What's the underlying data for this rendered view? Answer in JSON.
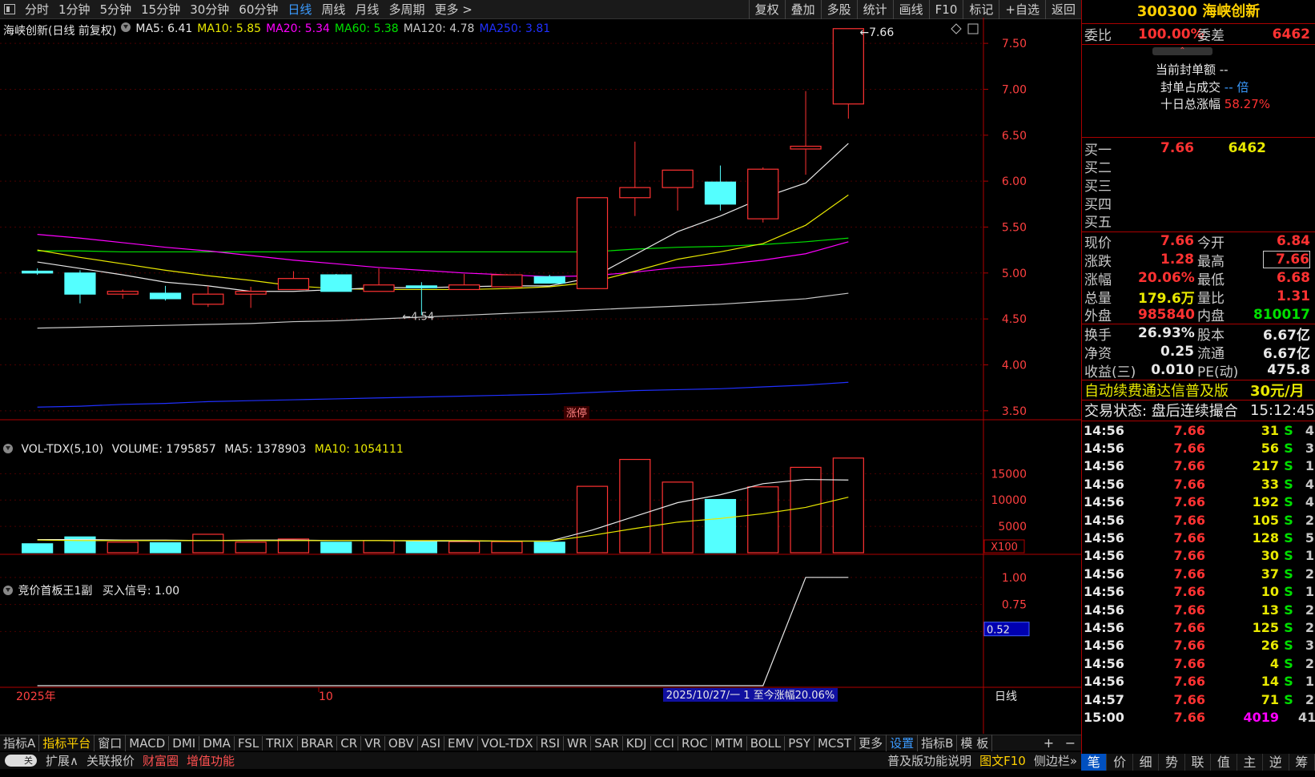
{
  "topbar": {
    "periods": [
      "分时",
      "1分钟",
      "5分钟",
      "15分钟",
      "30分钟",
      "60分钟",
      "日线",
      "周线",
      "月线",
      "多周期",
      "更多 >"
    ],
    "active_period": "日线",
    "tools": [
      "复权",
      "叠加",
      "多股",
      "统计",
      "画线",
      "F10",
      "标记",
      "+自选",
      "返回"
    ]
  },
  "main_legend": {
    "name": "海峡创新(日线 前复权)",
    "ma5": "MA5: 6.41",
    "ma10": "MA10: 5.85",
    "ma20": "MA20: 5.34",
    "ma60": "MA60: 5.38",
    "ma120": "MA120: 4.78",
    "ma250": "MA250: 3.81"
  },
  "colors": {
    "up": "#ff3232",
    "down": "#54ffff",
    "ma5": "#e8e8e8",
    "ma10": "#e8e800",
    "ma20": "#ff00ff",
    "ma60": "#00e000",
    "ma120": "#c8c8c8",
    "ma250": "#2030ff",
    "axis": "#b00000"
  },
  "price_axis": [
    "7.50",
    "7.00",
    "6.50",
    "6.00",
    "5.50",
    "5.00",
    "4.50",
    "4.00",
    "3.50"
  ],
  "annotations": {
    "high": "7.66",
    "low": "4.54",
    "zhangting": "涨停"
  },
  "vol_legend": {
    "name": "VOL-TDX(5,10)",
    "volume": "VOLUME: 1795857",
    "ma5": "MA5: 1378903",
    "ma10": "MA10: 1054111"
  },
  "vol_axis": [
    "15000",
    "10000",
    "5000"
  ],
  "vol_unit": "X100",
  "ind_legend": {
    "name": "竞价首板王1副",
    "signal": "买入信号: 1.00"
  },
  "ind_axis": [
    "1.00",
    "0.75",
    "0.50"
  ],
  "ind_current": "0.52",
  "x_axis": {
    "year": "2025年",
    "month": "10",
    "period": "日线"
  },
  "range_info": "2025/10/27/一 1 至今涨幅20.06%",
  "chart_data": {
    "type": "candlestick",
    "candles": [
      {
        "o": 5.02,
        "h": 5.05,
        "l": 4.98,
        "c": 5.0
      },
      {
        "o": 5.0,
        "h": 5.03,
        "l": 4.67,
        "c": 4.77
      },
      {
        "o": 4.77,
        "h": 4.82,
        "l": 4.72,
        "c": 4.8
      },
      {
        "o": 4.78,
        "h": 4.86,
        "l": 4.7,
        "c": 4.72
      },
      {
        "o": 4.66,
        "h": 4.86,
        "l": 4.63,
        "c": 4.77
      },
      {
        "o": 4.77,
        "h": 4.85,
        "l": 4.62,
        "c": 4.8
      },
      {
        "o": 4.82,
        "h": 5.02,
        "l": 4.82,
        "c": 4.94
      },
      {
        "o": 4.98,
        "h": 4.99,
        "l": 4.8,
        "c": 4.8
      },
      {
        "o": 4.8,
        "h": 5.05,
        "l": 4.8,
        "c": 4.87
      },
      {
        "o": 4.86,
        "h": 4.9,
        "l": 4.54,
        "c": 4.84
      },
      {
        "o": 4.82,
        "h": 4.99,
        "l": 4.82,
        "c": 4.87
      },
      {
        "o": 4.85,
        "h": 4.99,
        "l": 4.85,
        "c": 4.98
      },
      {
        "o": 4.96,
        "h": 4.98,
        "l": 4.89,
        "c": 4.89
      },
      {
        "o": 4.83,
        "h": 5.82,
        "l": 4.83,
        "c": 5.82
      },
      {
        "o": 5.82,
        "h": 6.43,
        "l": 5.62,
        "c": 5.93
      },
      {
        "o": 5.93,
        "h": 6.12,
        "l": 5.68,
        "c": 6.12
      },
      {
        "o": 5.99,
        "h": 6.17,
        "l": 5.68,
        "c": 5.75
      },
      {
        "o": 5.59,
        "h": 6.15,
        "l": 5.55,
        "c": 6.13
      },
      {
        "o": 6.35,
        "h": 6.98,
        "l": 6.07,
        "c": 6.38
      },
      {
        "o": 6.84,
        "h": 7.66,
        "l": 6.68,
        "c": 7.66
      }
    ],
    "ma5": [
      5.12,
      5.05,
      4.98,
      4.9,
      4.86,
      4.8,
      4.8,
      4.82,
      4.84,
      4.84,
      4.85,
      4.86,
      4.86,
      4.95,
      5.2,
      5.45,
      5.62,
      5.82,
      5.98,
      6.41
    ],
    "ma10": [
      5.25,
      5.17,
      5.1,
      5.03,
      4.97,
      4.92,
      4.86,
      4.83,
      4.82,
      4.82,
      4.82,
      4.83,
      4.85,
      4.9,
      5.02,
      5.15,
      5.23,
      5.32,
      5.52,
      5.85
    ],
    "ma20": [
      5.42,
      5.38,
      5.33,
      5.28,
      5.24,
      5.19,
      5.14,
      5.1,
      5.06,
      5.03,
      5.0,
      4.98,
      4.96,
      4.97,
      5.01,
      5.06,
      5.09,
      5.14,
      5.21,
      5.34
    ],
    "ma60": [
      5.24,
      5.24,
      5.23,
      5.23,
      5.23,
      5.23,
      5.23,
      5.23,
      5.23,
      5.23,
      5.23,
      5.23,
      5.23,
      5.23,
      5.26,
      5.28,
      5.29,
      5.31,
      5.34,
      5.38
    ],
    "ma120": [
      4.4,
      4.41,
      4.42,
      4.43,
      4.44,
      4.45,
      4.47,
      4.48,
      4.5,
      4.52,
      4.54,
      4.56,
      4.58,
      4.6,
      4.62,
      4.64,
      4.66,
      4.69,
      4.72,
      4.78
    ],
    "ma250": [
      3.54,
      3.55,
      3.57,
      3.58,
      3.6,
      3.61,
      3.62,
      3.63,
      3.64,
      3.65,
      3.66,
      3.67,
      3.68,
      3.7,
      3.72,
      3.73,
      3.74,
      3.76,
      3.78,
      3.81
    ],
    "volumes": [
      1700,
      3000,
      2000,
      1900,
      3500,
      2000,
      2600,
      2000,
      2300,
      2100,
      2100,
      2100,
      2000,
      12600,
      17700,
      13400,
      10100,
      12500,
      16200,
      17959
    ],
    "vol_ma5": [
      2500,
      2500,
      2400,
      2400,
      2300,
      2400,
      2400,
      2300,
      2300,
      2200,
      2200,
      2200,
      2200,
      4300,
      6900,
      9500,
      11000,
      13100,
      13900,
      13789
    ],
    "vol_ma10": [
      2400,
      2300,
      2300,
      2300,
      2300,
      2300,
      2300,
      2300,
      2300,
      2300,
      2300,
      2200,
      2200,
      3300,
      4600,
      5800,
      6500,
      7400,
      8600,
      10541
    ],
    "signal": [
      0,
      0,
      0,
      0,
      0,
      0,
      0,
      0,
      0,
      0,
      0,
      0,
      0,
      0,
      0,
      0,
      0,
      0,
      1,
      1
    ],
    "ylim": [
      3.42,
      7.78
    ]
  },
  "quote": {
    "code_name": "300300 海峡创新",
    "weibi_label": "委比",
    "weibi": "100.00%",
    "weicha_label": "委差",
    "weicha": "6462",
    "seal_amount": "当前封单额 --",
    "seal_ratio_label": "封单占成交",
    "seal_ratio": "-- 倍",
    "ten_day_label": "十日总涨幅",
    "ten_day": "58.27%",
    "bids": [
      {
        "label": "买一",
        "price": "7.66",
        "vol": "6462"
      },
      {
        "label": "买二",
        "price": "",
        "vol": ""
      },
      {
        "label": "买三",
        "price": "",
        "vol": ""
      },
      {
        "label": "买四",
        "price": "",
        "vol": ""
      },
      {
        "label": "买五",
        "price": "",
        "vol": ""
      }
    ],
    "stats": [
      {
        "l1": "现价",
        "v1": "7.66",
        "l2": "今开",
        "v2": "6.84"
      },
      {
        "l1": "涨跌",
        "v1": "1.28",
        "l2": "最高",
        "v2": "7.66"
      },
      {
        "l1": "涨幅",
        "v1": "20.06%",
        "l2": "最低",
        "v2": "6.68"
      },
      {
        "l1": "总量",
        "v1": "179.6万",
        "l2": "量比",
        "v2": "1.31"
      },
      {
        "l1": "外盘",
        "v1": "985840",
        "l2": "内盘",
        "v2": "810017"
      },
      {
        "l1": "换手",
        "v1": "26.93%",
        "l2": "股本",
        "v2": "6.67亿"
      },
      {
        "l1": "净资",
        "v1": "0.25",
        "l2": "流通",
        "v2": "6.67亿"
      },
      {
        "l1": "收益(三)",
        "v1": "0.010",
        "l2": "PE(动)",
        "v2": "475.8"
      }
    ],
    "ad": "自动续费通达信普及版",
    "ad_price": "30元/月",
    "status": "交易状态: 盘后连续撮合",
    "time": "15:12:45"
  },
  "ticks": [
    {
      "t": "14:56",
      "p": "7.66",
      "v": "31",
      "s": "S",
      "n": "4"
    },
    {
      "t": "14:56",
      "p": "7.66",
      "v": "56",
      "s": "S",
      "n": "3"
    },
    {
      "t": "14:56",
      "p": "7.66",
      "v": "217",
      "s": "S",
      "n": "1"
    },
    {
      "t": "14:56",
      "p": "7.66",
      "v": "33",
      "s": "S",
      "n": "4"
    },
    {
      "t": "14:56",
      "p": "7.66",
      "v": "192",
      "s": "S",
      "n": "4"
    },
    {
      "t": "14:56",
      "p": "7.66",
      "v": "105",
      "s": "S",
      "n": "2"
    },
    {
      "t": "14:56",
      "p": "7.66",
      "v": "128",
      "s": "S",
      "n": "5"
    },
    {
      "t": "14:56",
      "p": "7.66",
      "v": "30",
      "s": "S",
      "n": "1"
    },
    {
      "t": "14:56",
      "p": "7.66",
      "v": "37",
      "s": "S",
      "n": "2"
    },
    {
      "t": "14:56",
      "p": "7.66",
      "v": "10",
      "s": "S",
      "n": "1"
    },
    {
      "t": "14:56",
      "p": "7.66",
      "v": "13",
      "s": "S",
      "n": "2"
    },
    {
      "t": "14:56",
      "p": "7.66",
      "v": "125",
      "s": "S",
      "n": "2"
    },
    {
      "t": "14:56",
      "p": "7.66",
      "v": "26",
      "s": "S",
      "n": "3"
    },
    {
      "t": "14:56",
      "p": "7.66",
      "v": "4",
      "s": "S",
      "n": "2"
    },
    {
      "t": "14:56",
      "p": "7.66",
      "v": "14",
      "s": "S",
      "n": "1"
    },
    {
      "t": "14:57",
      "p": "7.66",
      "v": "71",
      "s": "S",
      "n": "2"
    },
    {
      "t": "15:00",
      "p": "7.66",
      "v": "4019",
      "s": "",
      "n": "41"
    }
  ],
  "indicator_tabs": [
    "指标A",
    "指标平台",
    "窗口",
    "MACD",
    "DMI",
    "DMA",
    "FSL",
    "TRIX",
    "BRAR",
    "CR",
    "VR",
    "OBV",
    "ASI",
    "EMV",
    "VOL-TDX",
    "RSI",
    "WR",
    "SAR",
    "KDJ",
    "CCI",
    "ROC",
    "MTM",
    "BOLL",
    "PSY",
    "MCST",
    "更多",
    "设置",
    "指标B",
    "模 板"
  ],
  "bottom_bar": [
    "扩展∧",
    "关联报价",
    "财富圈",
    "增值功能",
    "普及版功能说明",
    "图文F10",
    "侧边栏»"
  ],
  "right_tabs": [
    "笔",
    "价",
    "细",
    "势",
    "联",
    "值",
    "主",
    "逆",
    "筹"
  ],
  "toggle_label": "关"
}
